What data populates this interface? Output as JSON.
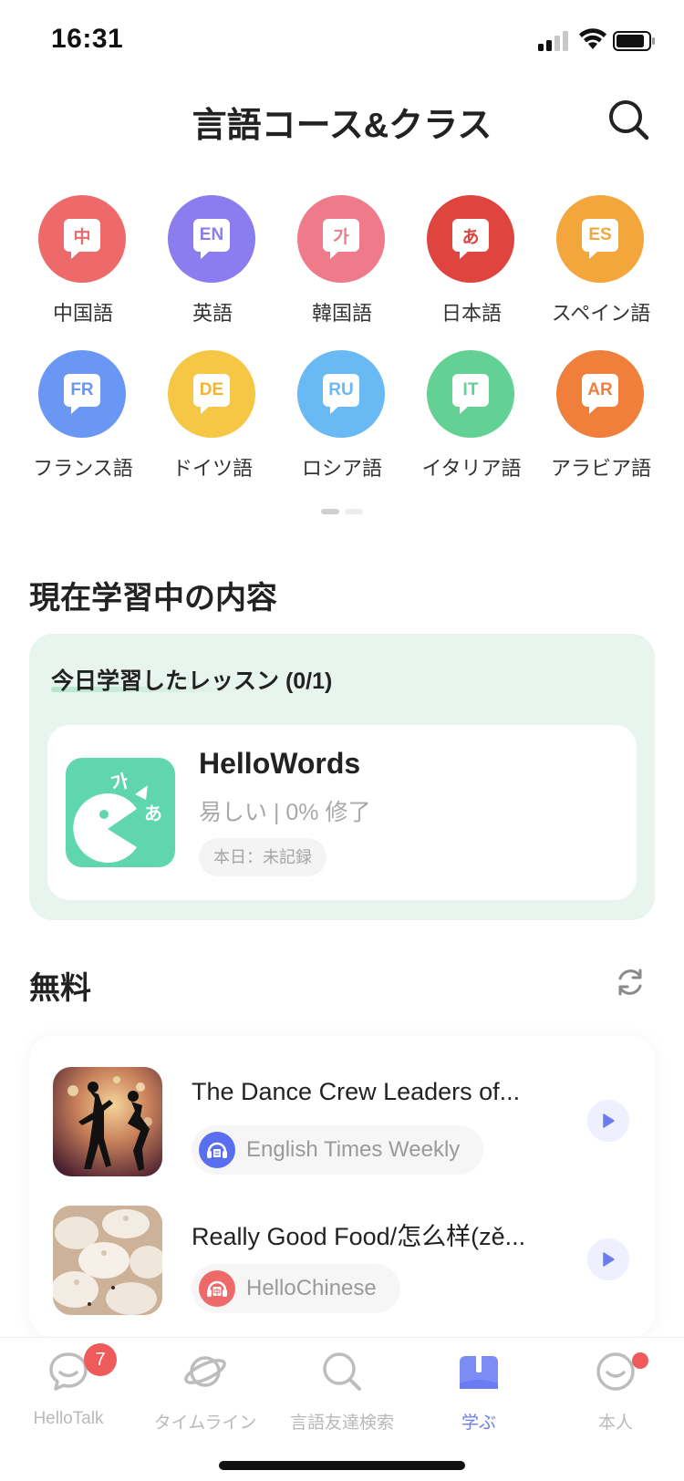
{
  "status_bar": {
    "time": "16:31"
  },
  "header": {
    "title": "言語コース&クラス"
  },
  "languages": [
    {
      "label": "中国語",
      "code": "中",
      "color": "#ee6a6a",
      "text_color": "#ee6a6a"
    },
    {
      "label": "英語",
      "code": "EN",
      "color": "#8b7cf0",
      "text_color": "#8b7cf0"
    },
    {
      "label": "韓国語",
      "code": "가",
      "color": "#ef7a8a",
      "text_color": "#ef7a8a"
    },
    {
      "label": "日本語",
      "code": "あ",
      "color": "#e0443f",
      "text_color": "#e0443f"
    },
    {
      "label": "スペイン語",
      "code": "ES",
      "color": "#f3a63b",
      "text_color": "#f3a63b"
    },
    {
      "label": "フランス語",
      "code": "FR",
      "color": "#6a96f4",
      "text_color": "#6a96f4"
    },
    {
      "label": "ドイツ語",
      "code": "DE",
      "color": "#f6c645",
      "text_color": "#f3b531"
    },
    {
      "label": "ロシア語",
      "code": "RU",
      "color": "#68b9f4",
      "text_color": "#68b9f4"
    },
    {
      "label": "イタリア語",
      "code": "IT",
      "color": "#63d193",
      "text_color": "#63d193"
    },
    {
      "label": "アラビア語",
      "code": "AR",
      "color": "#f07f3c",
      "text_color": "#f07f3c"
    }
  ],
  "current": {
    "section_title": "現在学習中の内容",
    "today_label": "今日学習したレッスン (0/1)",
    "lesson": {
      "name": "HelloWords",
      "meta": "易しい | 0% 修了",
      "tag": "本日：未記録",
      "icon_text_1": "가",
      "icon_text_2": "あ"
    }
  },
  "free": {
    "section_title": "無料",
    "items": [
      {
        "title": "The Dance Crew Leaders of...",
        "source": "English Times Weekly",
        "source_color": "#5a6ff0"
      },
      {
        "title": "Really Good Food/怎么样(zě...",
        "source": "HelloChinese",
        "source_color": "#ee6a6a",
        "source_glyph": "中"
      }
    ]
  },
  "tabs": [
    {
      "label": "HelloTalk",
      "badge": "7"
    },
    {
      "label": "タイムライン"
    },
    {
      "label": "言語友達検索"
    },
    {
      "label": "学ぶ",
      "active": true
    },
    {
      "label": "本人"
    }
  ],
  "colors": {
    "accent": "#6b7cf0",
    "card_green": "#e8f5ee",
    "badge_red": "#ef5a5a"
  }
}
